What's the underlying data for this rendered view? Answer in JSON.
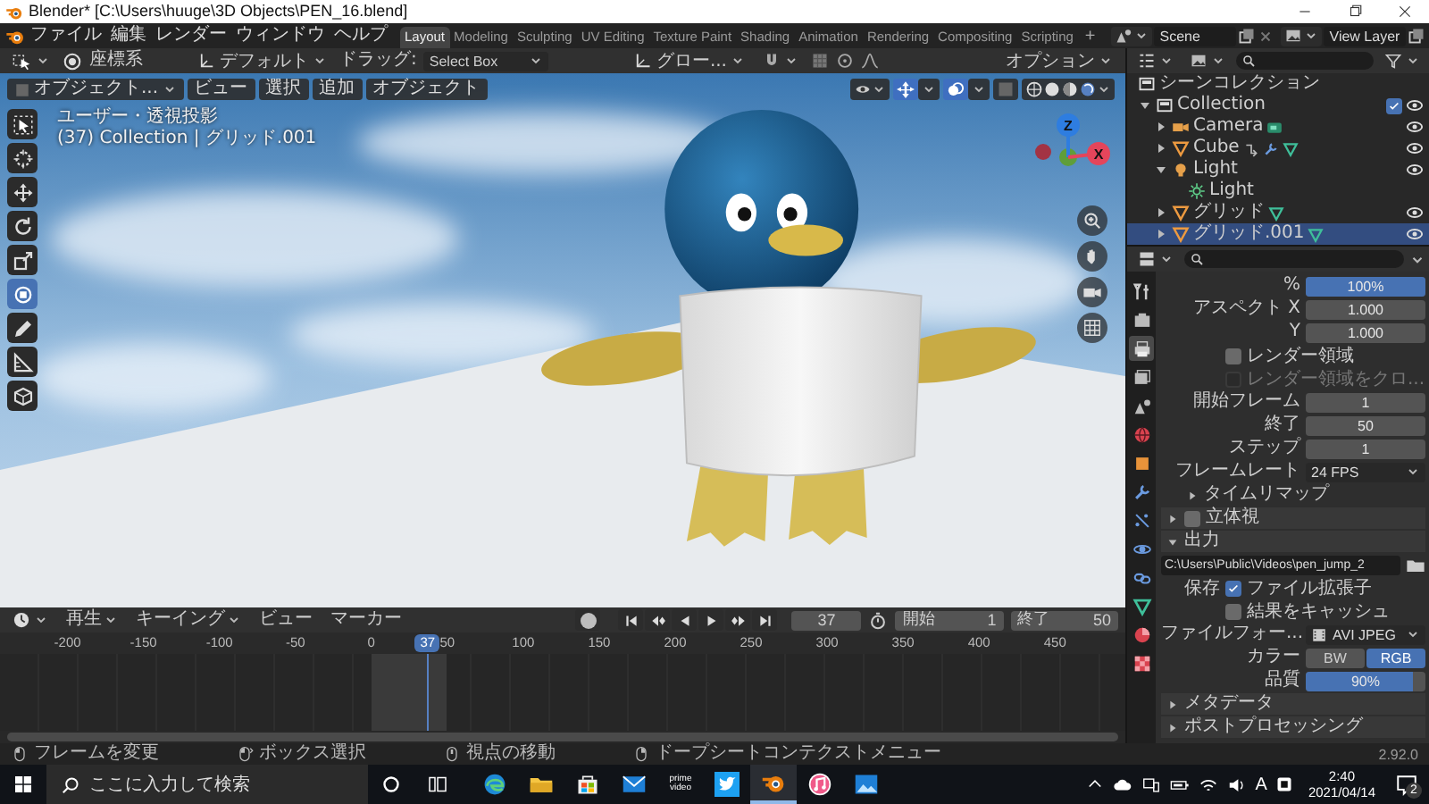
{
  "title_bar": {
    "title": "Blender* [C:\\Users\\huuge\\3D Objects\\PEN_16.blend]"
  },
  "top_bar": {
    "menus": [
      "ファイル",
      "編集",
      "レンダー",
      "ウィンドウ",
      "ヘルプ"
    ],
    "tabs": [
      {
        "label": "Layout",
        "selected": true
      },
      {
        "label": "Modeling",
        "selected": false
      },
      {
        "label": "Sculpting",
        "selected": false
      },
      {
        "label": "UV Editing",
        "selected": false
      },
      {
        "label": "Texture Paint",
        "selected": false
      },
      {
        "label": "Shading",
        "selected": false
      },
      {
        "label": "Animation",
        "selected": false
      },
      {
        "label": "Rendering",
        "selected": false
      },
      {
        "label": "Compositing",
        "selected": false
      },
      {
        "label": "Scripting",
        "selected": false
      }
    ],
    "add_tab": "+",
    "scene": "Scene",
    "view_layer": "View Layer"
  },
  "viewport_header": {
    "coord_label": "座標系",
    "orientation": "デフォルト",
    "drag_label": "ドラッグ:",
    "drag_value": "Select Box",
    "pivot": "グロー...",
    "options": "オプション"
  },
  "viewport": {
    "mode": "オブジェクト...",
    "menus": [
      "ビュー",
      "選択",
      "追加",
      "オブジェクト"
    ],
    "view_name": "ユーザー・透視投影",
    "context": "(37) Collection | グリッド.001",
    "tools": [
      {
        "kind": "select_box",
        "selected": false
      },
      {
        "kind": "cursor",
        "selected": false
      },
      {
        "kind": "move",
        "selected": false
      },
      {
        "kind": "rotate",
        "selected": false
      },
      {
        "kind": "scale",
        "selected": false
      },
      {
        "kind": "transform",
        "selected": true
      },
      {
        "kind": "annotate",
        "selected": false
      },
      {
        "kind": "measure",
        "selected": false
      },
      {
        "kind": "add_cube",
        "selected": false
      }
    ],
    "show_gizmo": true,
    "show_overlays": true,
    "gizmo": [
      {
        "label": "Z",
        "color": "#2e7de0"
      },
      {
        "label": "X",
        "color": "#e4455b"
      }
    ]
  },
  "timeline": {
    "menus": [
      {
        "label": "再生",
        "dropdown": true
      },
      {
        "label": "キーイング",
        "dropdown": true
      },
      {
        "label": "ビュー",
        "dropdown": false
      },
      {
        "label": "マーカー",
        "dropdown": false
      }
    ],
    "record": false,
    "current_frame": "37",
    "start_label": "開始",
    "start": "1",
    "end_label": "終了",
    "end": "50",
    "ticks": [
      "-200",
      "-150",
      "-100",
      "-50",
      "0",
      "50",
      "100",
      "150",
      "200",
      "250",
      "300",
      "350",
      "400",
      "450"
    ],
    "playhead": {
      "label": "37",
      "level": 0.38
    }
  },
  "outliner": {
    "root_label": "シーンコレクション",
    "items": [
      {
        "label": "Collection",
        "kind": "collection",
        "expanded": true,
        "checked": true,
        "selected": false,
        "children": [
          {
            "label": "Camera",
            "kind": "camera",
            "expanded": false,
            "selected": false
          },
          {
            "label": "Cube",
            "kind": "mesh_modified",
            "expanded": false,
            "selected": false
          },
          {
            "label": "Light",
            "kind": "light",
            "expanded": true,
            "selected": false,
            "children": [
              {
                "label": "Light",
                "kind": "light_data",
                "selected": false
              }
            ]
          },
          {
            "label": "グリッド",
            "kind": "mesh",
            "expanded": false,
            "selected": false
          },
          {
            "label": "グリッド.001",
            "kind": "mesh",
            "expanded": false,
            "selected": true
          }
        ]
      }
    ]
  },
  "properties": {
    "tabs": [
      {
        "kind": "tool",
        "selected": false
      },
      {
        "kind": "render",
        "selected": false
      },
      {
        "kind": "output",
        "selected": true
      },
      {
        "kind": "view_layer",
        "selected": false
      },
      {
        "kind": "scene",
        "selected": false
      },
      {
        "kind": "world",
        "selected": false
      },
      {
        "kind": "object",
        "selected": false
      },
      {
        "kind": "modifier",
        "selected": false
      },
      {
        "kind": "particles",
        "selected": false
      },
      {
        "kind": "physics",
        "selected": false
      },
      {
        "kind": "constraints",
        "selected": false
      },
      {
        "kind": "data",
        "selected": false
      },
      {
        "kind": "material",
        "selected": false
      },
      {
        "kind": "texture",
        "selected": false
      }
    ],
    "rows": [
      {
        "kind": "slider",
        "label": "%",
        "value": "100%",
        "level": 1
      },
      {
        "kind": "number",
        "label": "アスペクト X",
        "value": "1.000"
      },
      {
        "kind": "number",
        "label": "Y",
        "value": "1.000"
      },
      {
        "kind": "checkbox",
        "label": "レンダー領域",
        "checked": false,
        "disabled": false
      },
      {
        "kind": "checkbox",
        "label": "レンダー領域をクロ...",
        "checked": false,
        "disabled": true
      },
      {
        "kind": "number",
        "label": "開始フレーム",
        "value": "1"
      },
      {
        "kind": "number",
        "label": "終了",
        "value": "50"
      },
      {
        "kind": "number",
        "label": "ステップ",
        "value": "1"
      },
      {
        "kind": "dropdown",
        "label": "フレームレート",
        "value": "24 FPS"
      },
      {
        "kind": "subpanel",
        "label": "タイムリマップ",
        "expanded": false
      },
      {
        "kind": "panel",
        "label": "立体視",
        "expanded": false,
        "checked": false
      },
      {
        "kind": "panel",
        "label": "出力",
        "expanded": true
      },
      {
        "kind": "path",
        "value": "C:\\Users\\Public\\Videos\\pen_jump_2"
      },
      {
        "kind": "checkbox",
        "prefix": "保存",
        "label": "ファイル拡張子",
        "checked": true,
        "disabled": false
      },
      {
        "kind": "checkbox",
        "label": "結果をキャッシュ",
        "checked": false,
        "disabled": false
      },
      {
        "kind": "format_dropdown",
        "label": "ファイルフォー...",
        "value": "AVI JPEG"
      },
      {
        "kind": "toggle",
        "label": "カラー",
        "options": [
          {
            "label": "BW",
            "selected": false
          },
          {
            "label": "RGB",
            "selected": true
          }
        ]
      },
      {
        "kind": "slider",
        "label": "品質",
        "value": "90%",
        "level": 0.9
      },
      {
        "kind": "panel",
        "label": "メタデータ",
        "expanded": false
      },
      {
        "kind": "panel",
        "label": "ポストプロセッシング",
        "expanded": false
      }
    ]
  },
  "status_bar": {
    "items": [
      {
        "text": "フレームを変更"
      },
      {
        "text": "ボックス選択"
      },
      {
        "text": "視点の移動"
      },
      {
        "text": "ドープシートコンテクストメニュー"
      }
    ],
    "version": "2.92.0"
  },
  "taskbar": {
    "search_placeholder": "ここに入力して検索",
    "apps": [
      {
        "kind": "edge",
        "active": false
      },
      {
        "kind": "explorer",
        "active": false
      },
      {
        "kind": "store",
        "active": false
      },
      {
        "kind": "mail",
        "active": false
      },
      {
        "kind": "prime_video",
        "label": "prime video",
        "active": false
      },
      {
        "kind": "twitter",
        "active": false
      },
      {
        "kind": "blender",
        "active": true
      },
      {
        "kind": "itunes",
        "active": false
      },
      {
        "kind": "photos",
        "active": false
      }
    ],
    "ime": "A",
    "time": "2:40",
    "date": "2021/04/14",
    "notifications": "2"
  }
}
